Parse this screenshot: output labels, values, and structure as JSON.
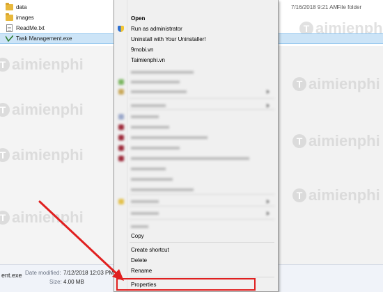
{
  "files": [
    {
      "name": "data",
      "date": "7/16/2018 9:21 AM",
      "type": "File folder",
      "icon": "folder-icon"
    },
    {
      "name": "images",
      "date": "",
      "type": "",
      "icon": "folder-icon"
    },
    {
      "name": "ReadMe.txt",
      "date": "",
      "type": "",
      "icon": "text-file-icon"
    },
    {
      "name": "Task Management.exe",
      "date": "",
      "type": "",
      "icon": "exe-icon",
      "selected": true
    }
  ],
  "menu": {
    "open": "Open",
    "run_as_admin": "Run as administrator",
    "uninstall": "Uninstall with Your Uninstaller!",
    "site1": "9mobi.vn",
    "site2": "Taimienphi.vn",
    "copy": "Copy",
    "create_shortcut": "Create shortcut",
    "delete": "Delete",
    "rename": "Rename",
    "properties": "Properties"
  },
  "details": {
    "name": "ent.exe",
    "modified_label": "Date modified:",
    "modified_value": "7/12/2018 12:03 PM",
    "size_label": "Size:",
    "size_value": "4.00 MB"
  },
  "watermark": {
    "text": "aimienphi",
    "badge": "T"
  },
  "colors": {
    "selection": "#cce4f7",
    "highlight": "#e02020",
    "arrow": "#e02020"
  }
}
